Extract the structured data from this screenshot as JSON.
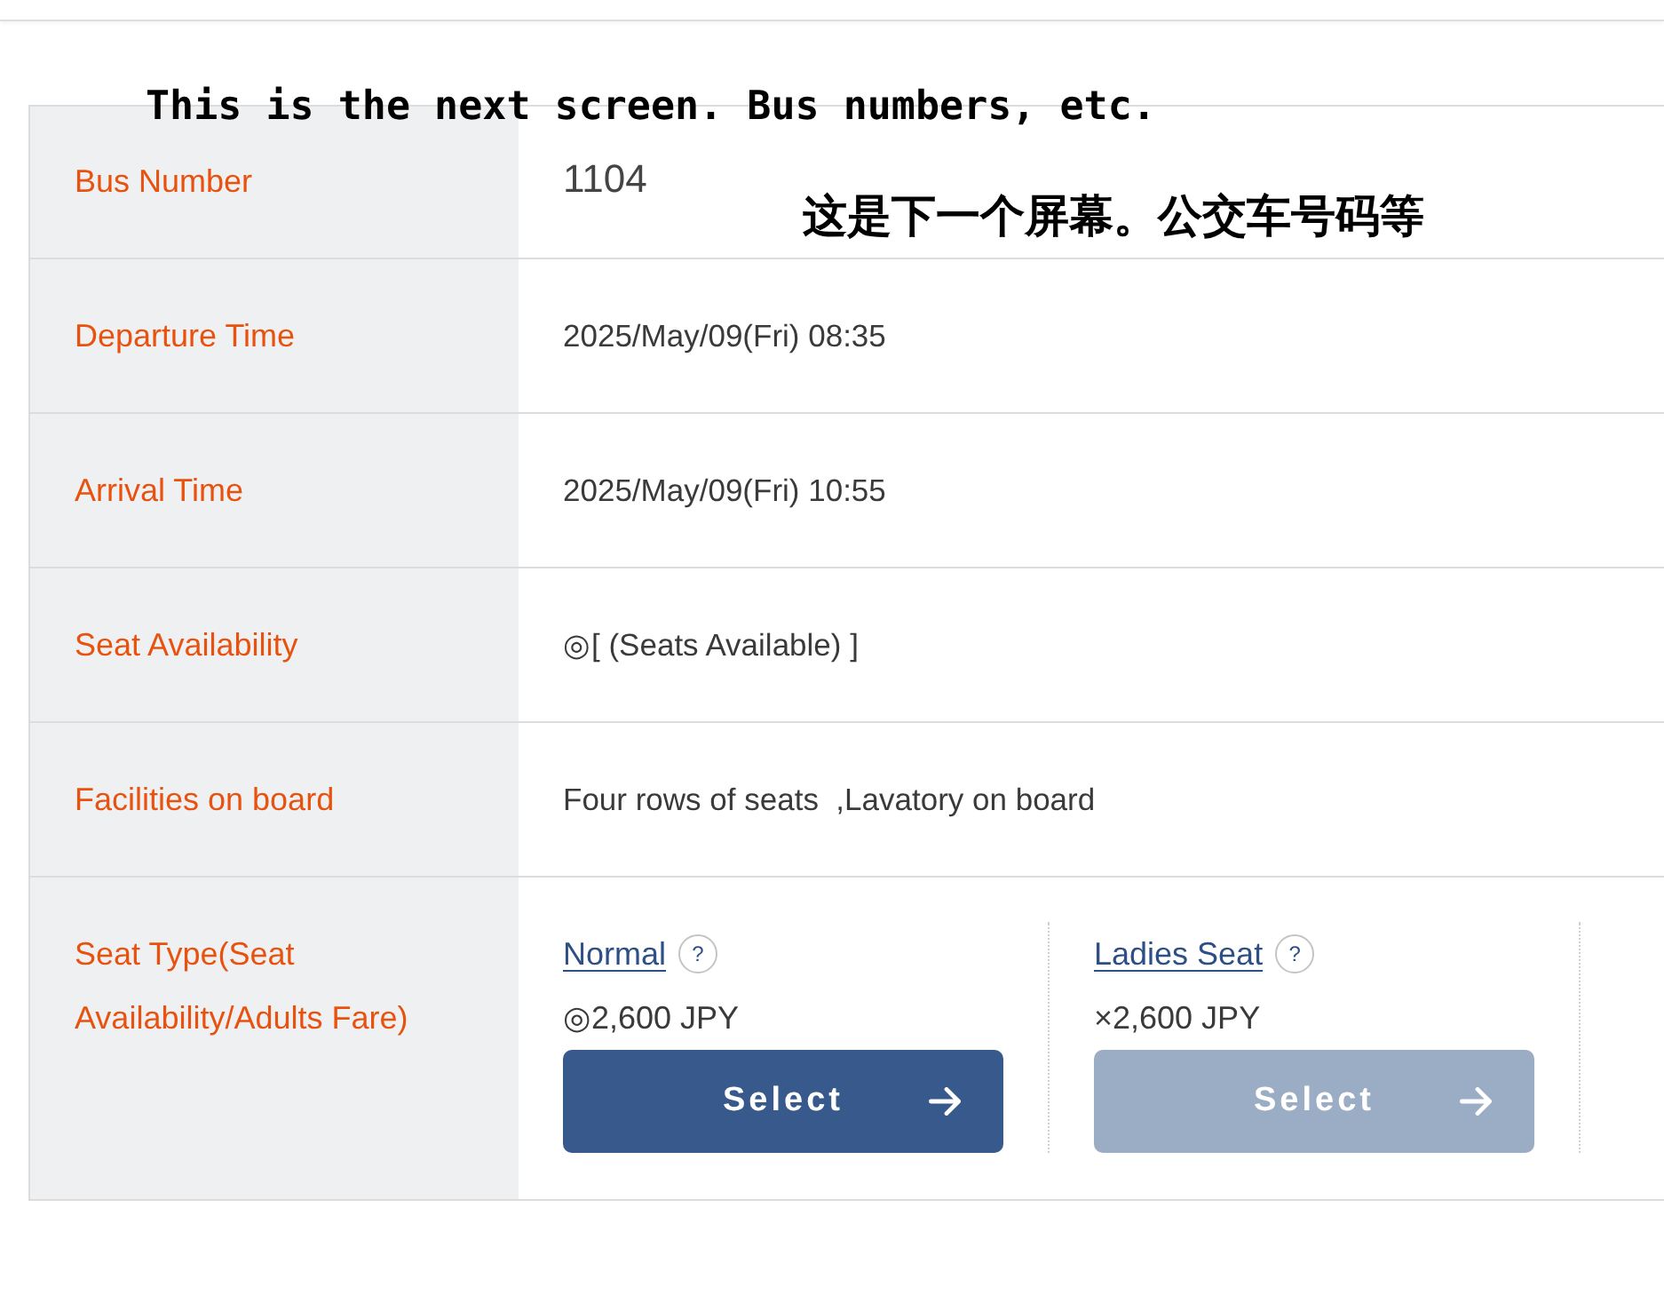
{
  "annotations": [
    {
      "kind": "latin",
      "text": "This is the next screen. Bus numbers, etc."
    },
    {
      "kind": "cjk",
      "text": "这是下一个屏幕。公交车号码等"
    }
  ],
  "details": {
    "rows": [
      {
        "label": "Bus Number",
        "value": "1104",
        "kind": "large"
      },
      {
        "label": "Departure Time",
        "value": "2025/May/09(Fri) 08:35",
        "kind": "text"
      },
      {
        "label": "Arrival Time",
        "value": "2025/May/09(Fri) 10:55",
        "kind": "text"
      },
      {
        "label": "Seat Availability",
        "value": "◎[ (Seats Available) ]",
        "kind": "text"
      },
      {
        "label": "Facilities on board",
        "value": "Four rows of seats  ,Lavatory on board",
        "kind": "text"
      }
    ]
  },
  "seat_type_row": {
    "label": "Seat Type(Seat Availability/Adults Fare)",
    "options": [
      {
        "name": "Normal",
        "help": "?",
        "price": "◎2,600 JPY",
        "button": "Select",
        "disabled": false
      },
      {
        "name": "Ladies Seat",
        "help": "?",
        "price": "×2,600 JPY",
        "button": "Select",
        "disabled": true
      }
    ]
  }
}
